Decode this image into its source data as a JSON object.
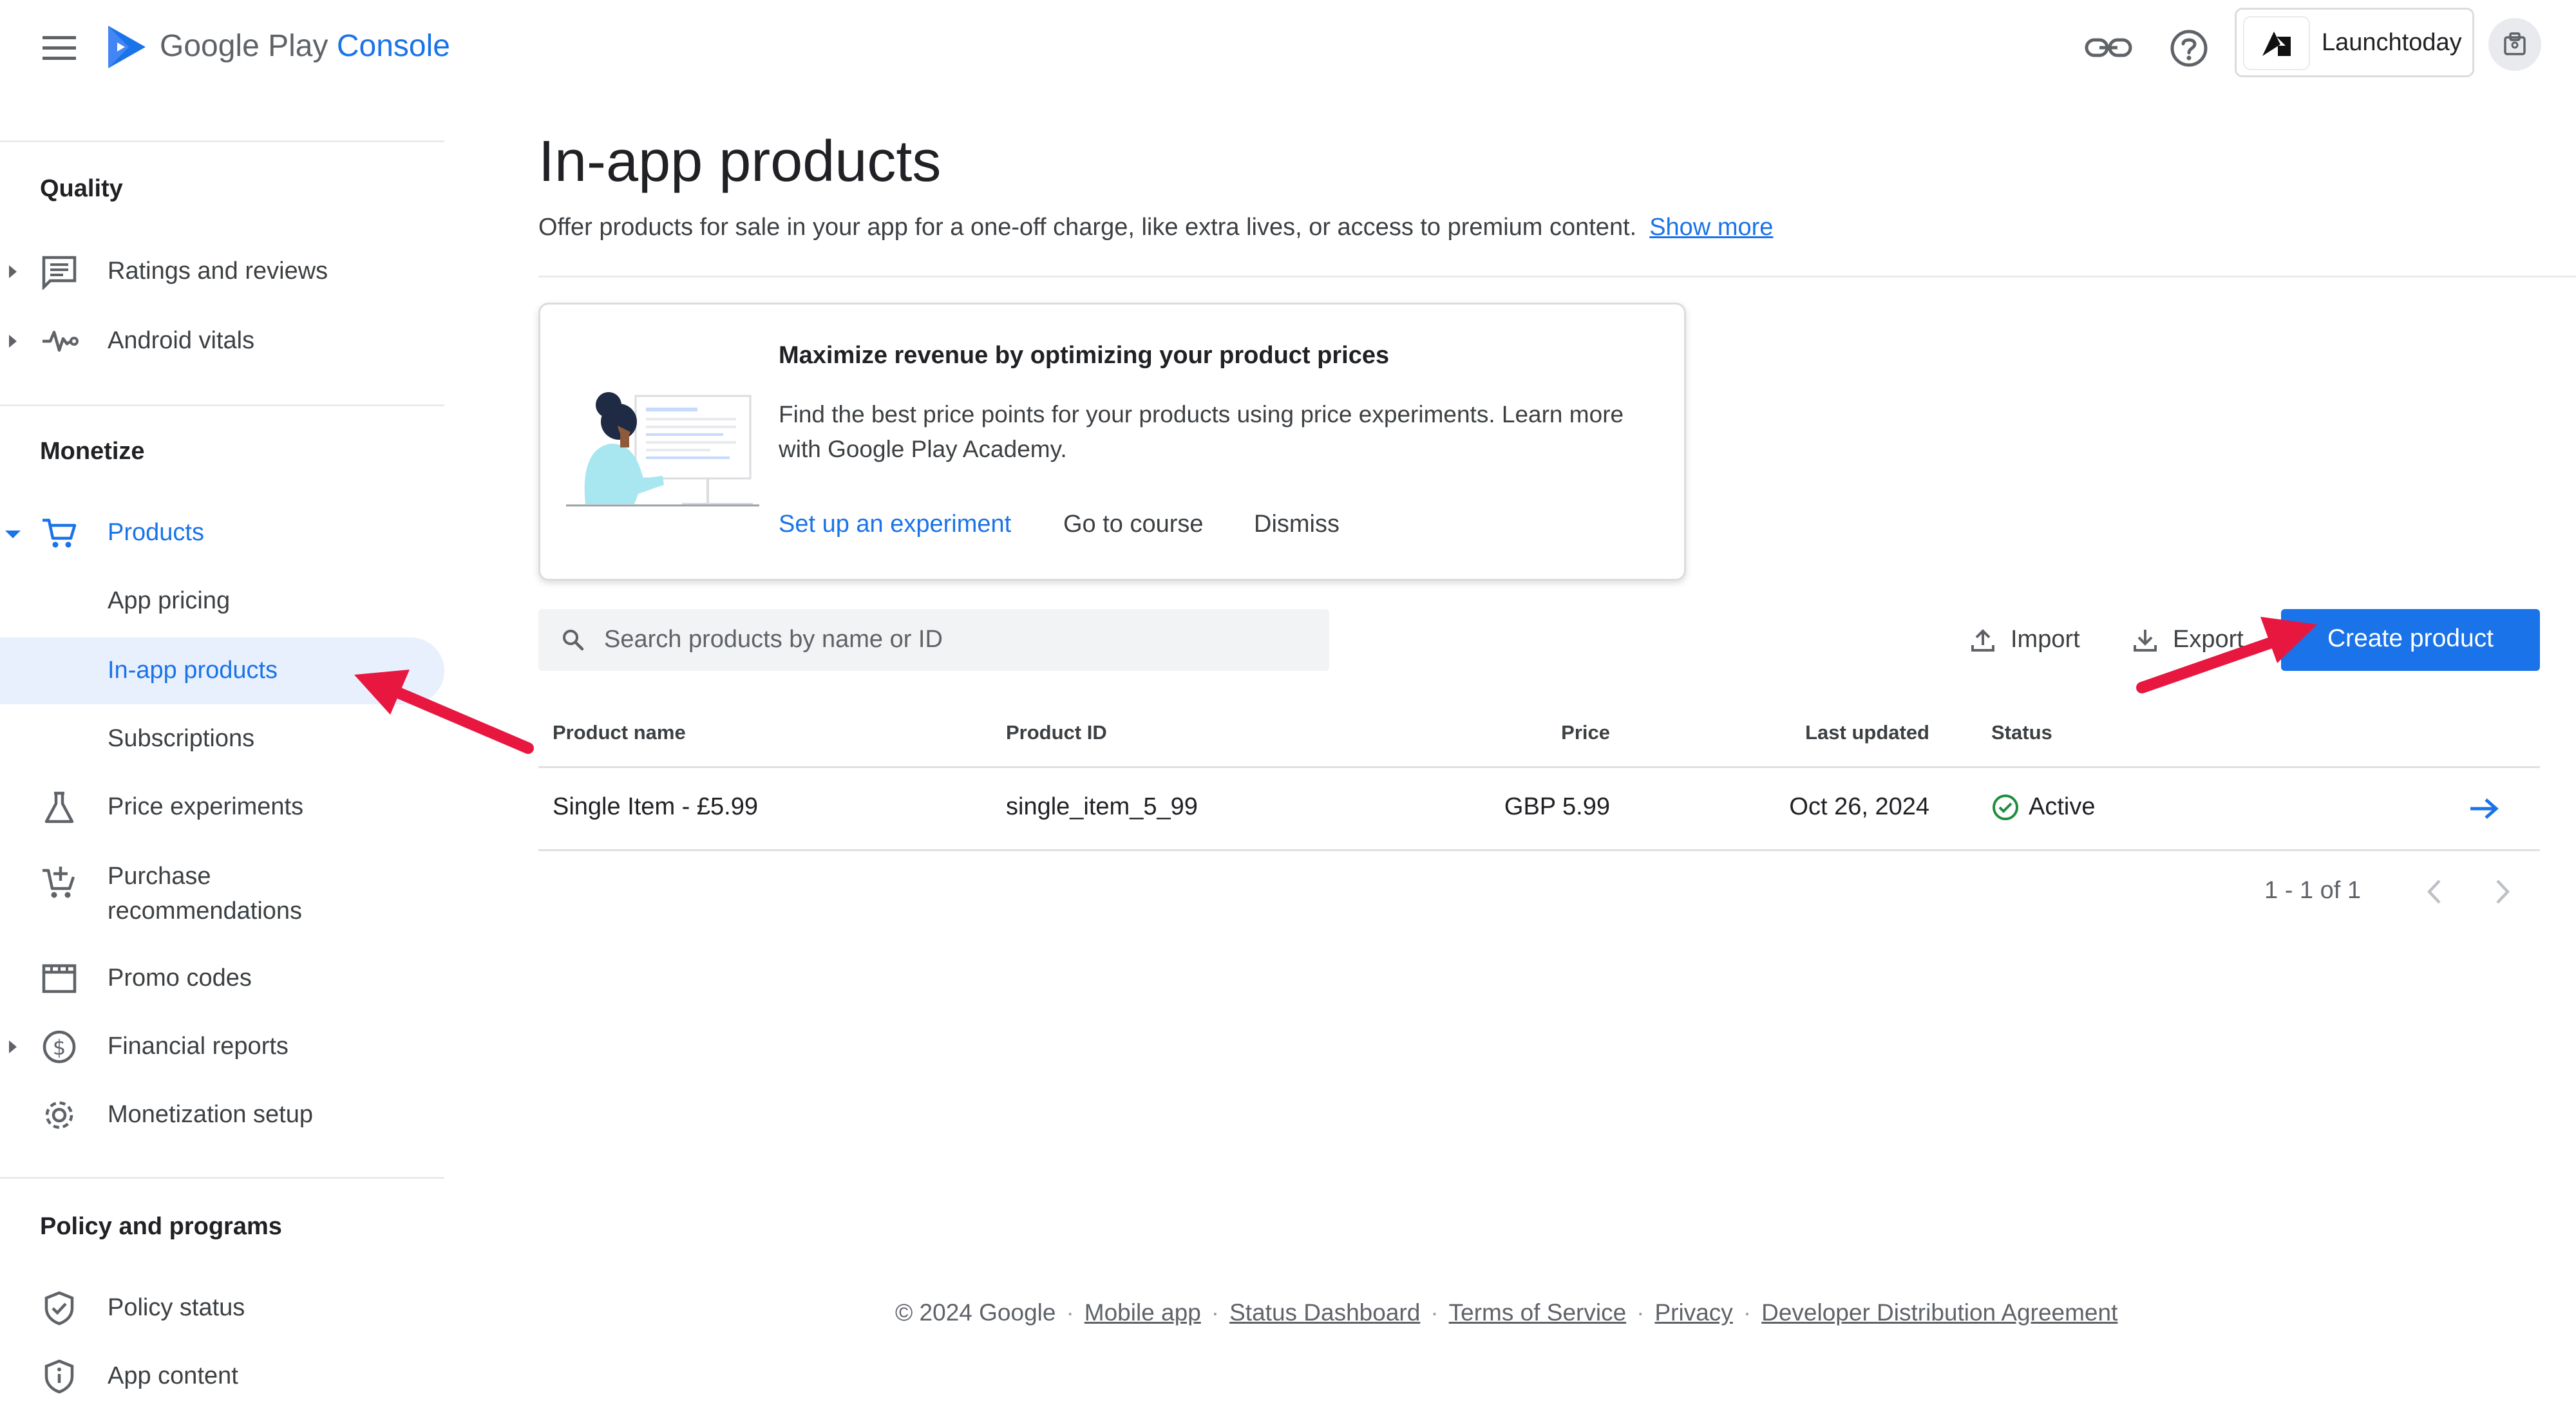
{
  "header": {
    "brand_google_play": "Google Play",
    "brand_console": "Console",
    "account_name": "Launchtoday",
    "icons": [
      "menu-icon",
      "play-console-logo",
      "link-icon",
      "help-icon",
      "account-logo",
      "profile-icon"
    ]
  },
  "sidebar": {
    "quality_heading": "Quality",
    "monetize_heading": "Monetize",
    "policy_heading": "Policy and programs",
    "items": {
      "ratings": "Ratings and reviews",
      "vitals": "Android vitals",
      "products": "Products",
      "app_pricing": "App pricing",
      "in_app_products": "In-app products",
      "subscriptions": "Subscriptions",
      "price_experiments": "Price experiments",
      "purchase_recommendations": "Purchase recommendations",
      "promo_codes": "Promo codes",
      "financial_reports": "Financial reports",
      "monetization_setup": "Monetization setup",
      "policy_status": "Policy status",
      "app_content": "App content"
    }
  },
  "page": {
    "title": "In-app products",
    "description": "Offer products for sale in your app for a one-off charge, like extra lives, or access to premium content.",
    "show_more": "Show more"
  },
  "promo_card": {
    "title": "Maximize revenue by optimizing your product prices",
    "body": "Find the best price points for your products using price experiments. Learn more with Google Play Academy.",
    "primary_action": "Set up an experiment",
    "course_action": "Go to course",
    "dismiss_action": "Dismiss"
  },
  "toolbar": {
    "search_placeholder": "Search products by name or ID",
    "import_label": "Import",
    "export_label": "Export",
    "create_label": "Create product"
  },
  "table": {
    "columns": [
      "Product name",
      "Product ID",
      "Price",
      "Last updated",
      "Status"
    ],
    "rows": [
      {
        "name": "Single Item - £5.99",
        "id": "single_item_5_99",
        "price": "GBP 5.99",
        "updated": "Oct 26, 2024",
        "status": "Active"
      }
    ],
    "pagination": "1 - 1 of 1"
  },
  "footer": {
    "copyright": "© 2024 Google",
    "links": [
      "Mobile app",
      "Status Dashboard",
      "Terms of Service",
      "Privacy",
      "Developer Distribution Agreement"
    ]
  },
  "colors": {
    "accent": "#1a73e8",
    "selected_bg": "#e8f0fe",
    "status_green": "#1e8e3e",
    "annotation_red": "#e8173f"
  }
}
